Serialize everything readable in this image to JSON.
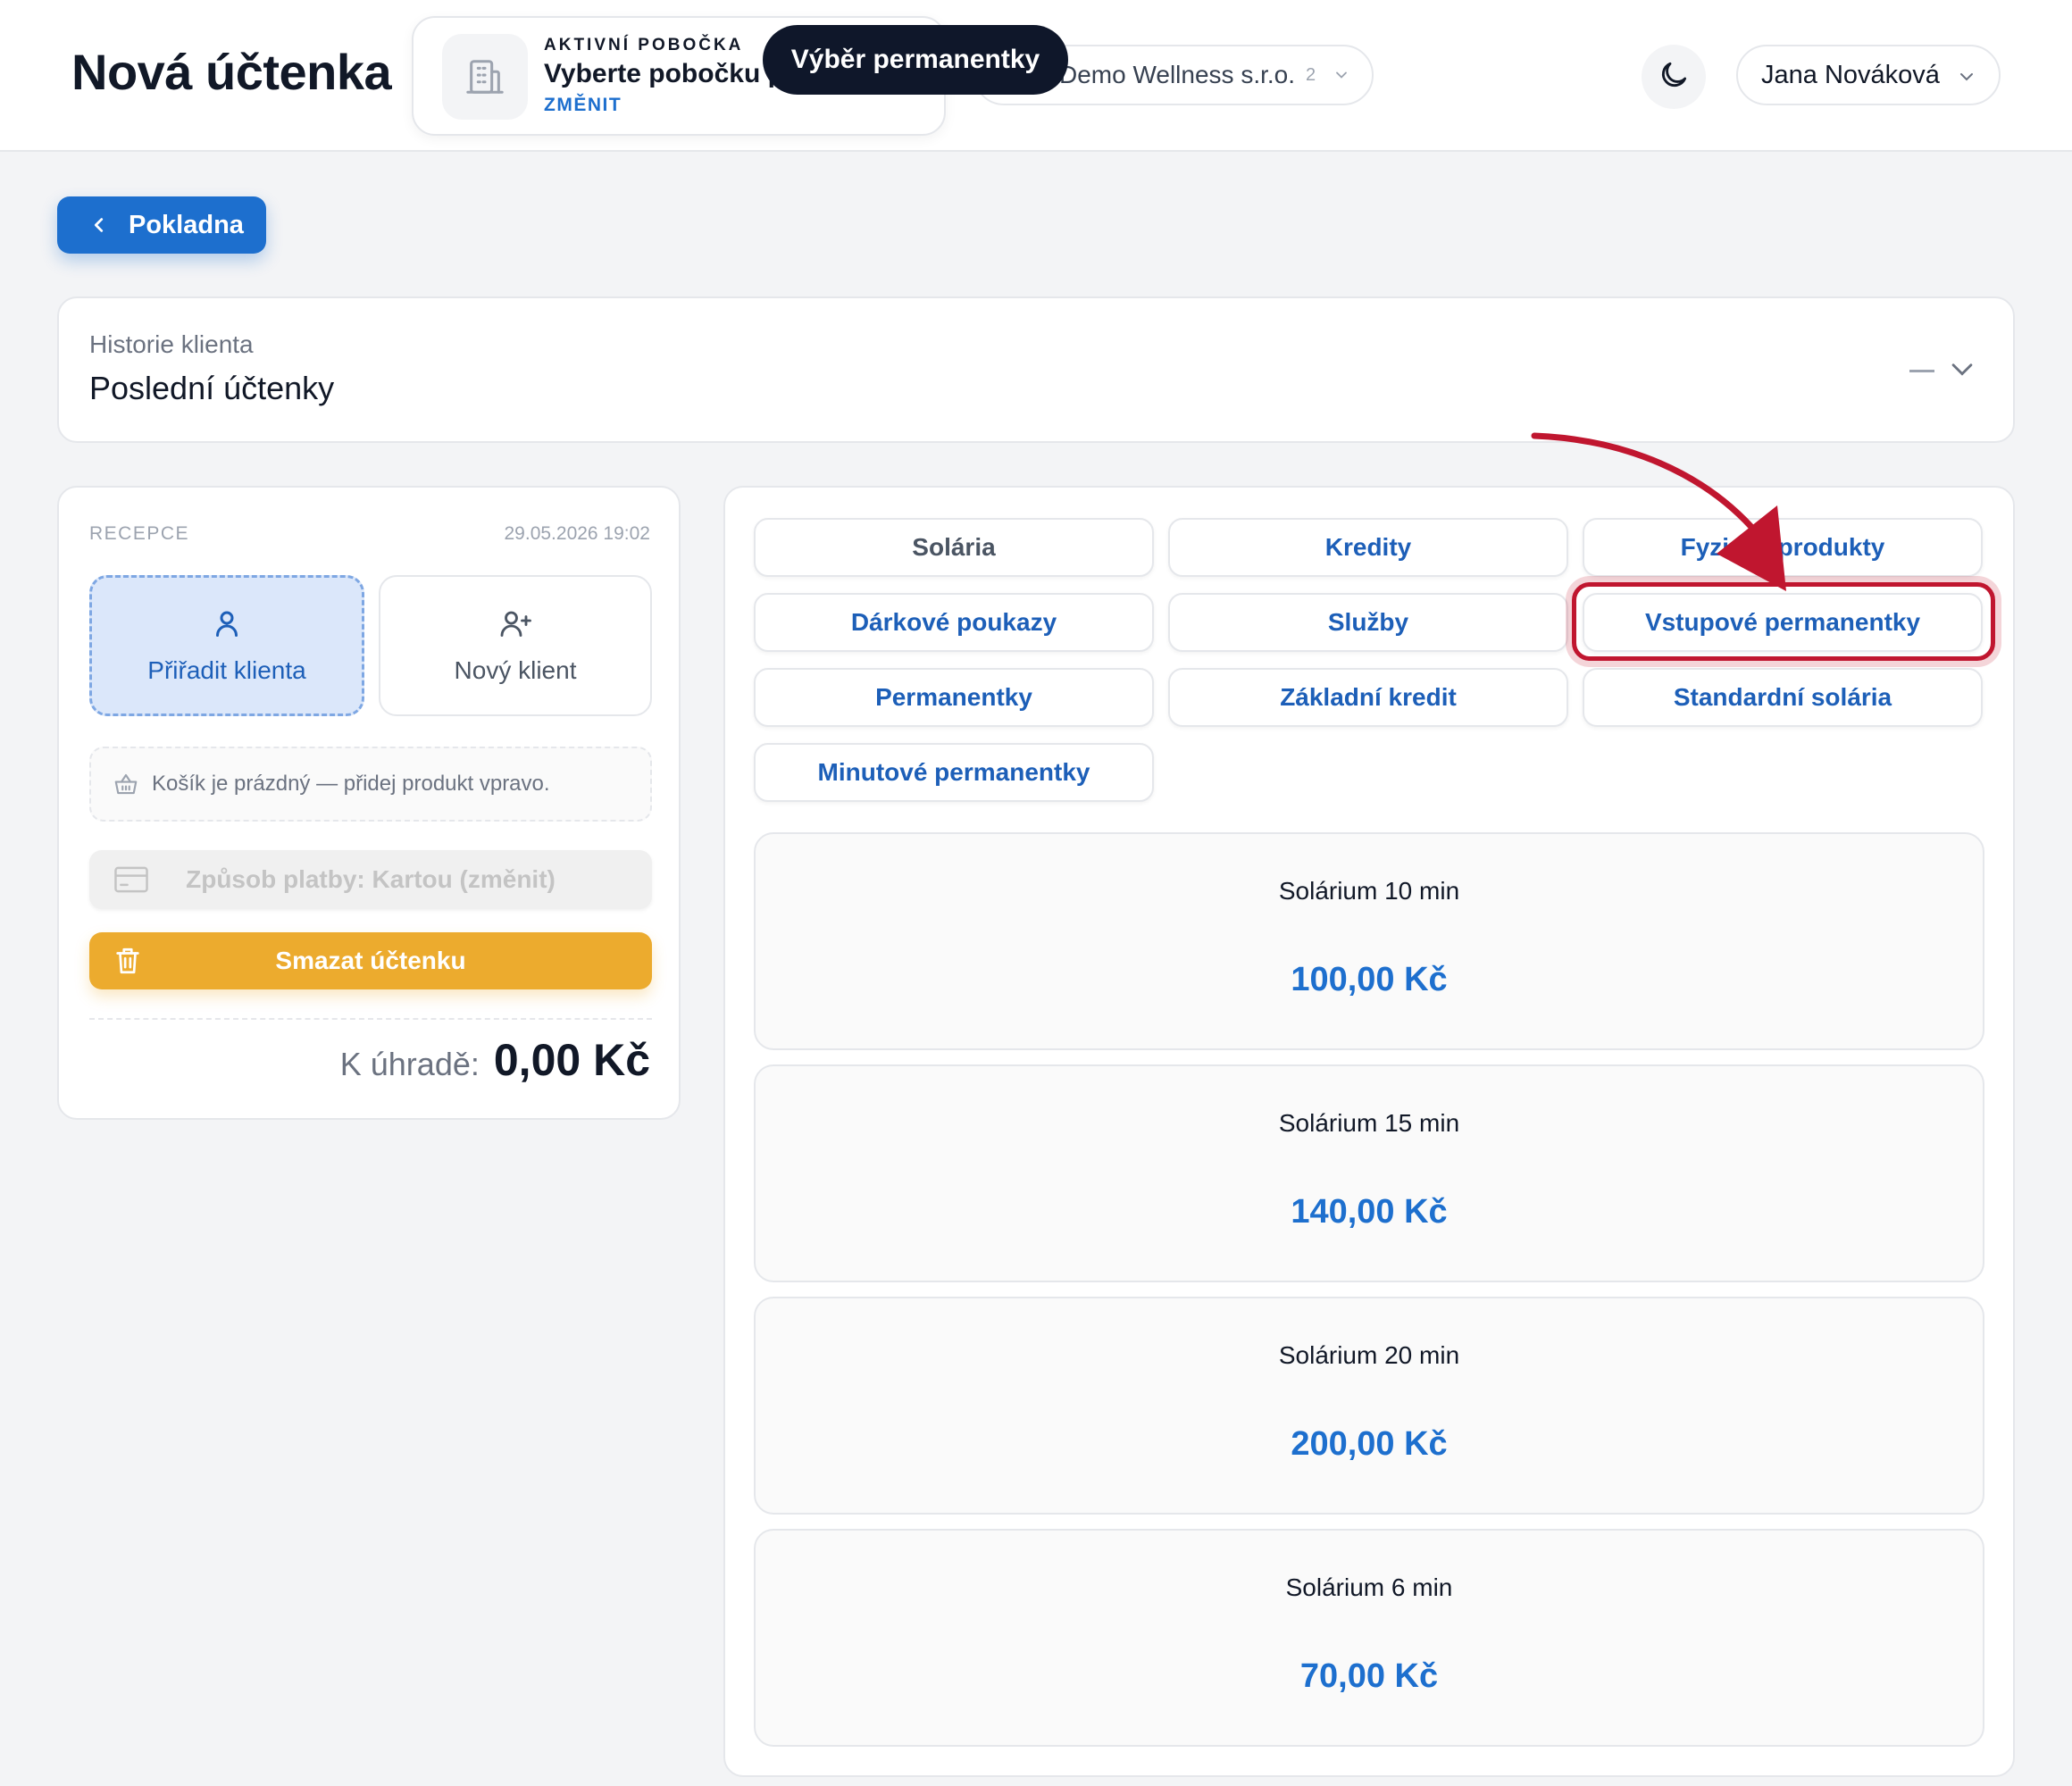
{
  "header": {
    "title": "Nová účtenka",
    "branch": {
      "label": "AKTIVNÍ POBOČKA",
      "name": "Vyberte pobočku pro účtenku",
      "change": "ZMĚNIT",
      "icon": "building-icon"
    },
    "tooltip": "Výběr permanentky",
    "company": {
      "name": "Demo Wellness s.r.o.",
      "count": "2"
    },
    "theme_icon": "moon-icon",
    "user": "Jana Nováková"
  },
  "back_button": "Pokladna",
  "history": {
    "subtitle": "Historie klienta",
    "title": "Poslední účtenky"
  },
  "left_panel": {
    "label": "RECEPCE",
    "datetime": "29.05.2026 19:02",
    "assign_client": "Přiřadit klienta",
    "new_client": "Nový klient",
    "cart_empty": "Košík je prázdný — přidej produkt vpravo.",
    "payment": "Způsob platby: Kartou (změnit)",
    "delete": "Smazat účtenku",
    "total_label": "K úhradě:",
    "total_value": "0,00 Kč"
  },
  "categories": [
    {
      "label": "Solária"
    },
    {
      "label": "Kredity"
    },
    {
      "label": "Fyzické produkty"
    },
    {
      "label": "Dárkové poukazy"
    },
    {
      "label": "Služby"
    },
    {
      "label": "Vstupové permanentky"
    },
    {
      "label": "Permanentky"
    },
    {
      "label": "Základní kredit"
    },
    {
      "label": "Standardní solária"
    },
    {
      "label": "Minutové permanentky"
    }
  ],
  "highlighted_category": "Vstupové permanentky",
  "products": [
    {
      "name": "Solárium 10 min",
      "price": "100,00 Kč"
    },
    {
      "name": "Solárium 15 min",
      "price": "140,00 Kč"
    },
    {
      "name": "Solárium 20 min",
      "price": "200,00 Kč"
    },
    {
      "name": "Solárium 6 min",
      "price": "70,00 Kč"
    }
  ],
  "colors": {
    "accent": "#1d6fce",
    "warning": "#ecab2e",
    "annotation": "#c0162f"
  }
}
